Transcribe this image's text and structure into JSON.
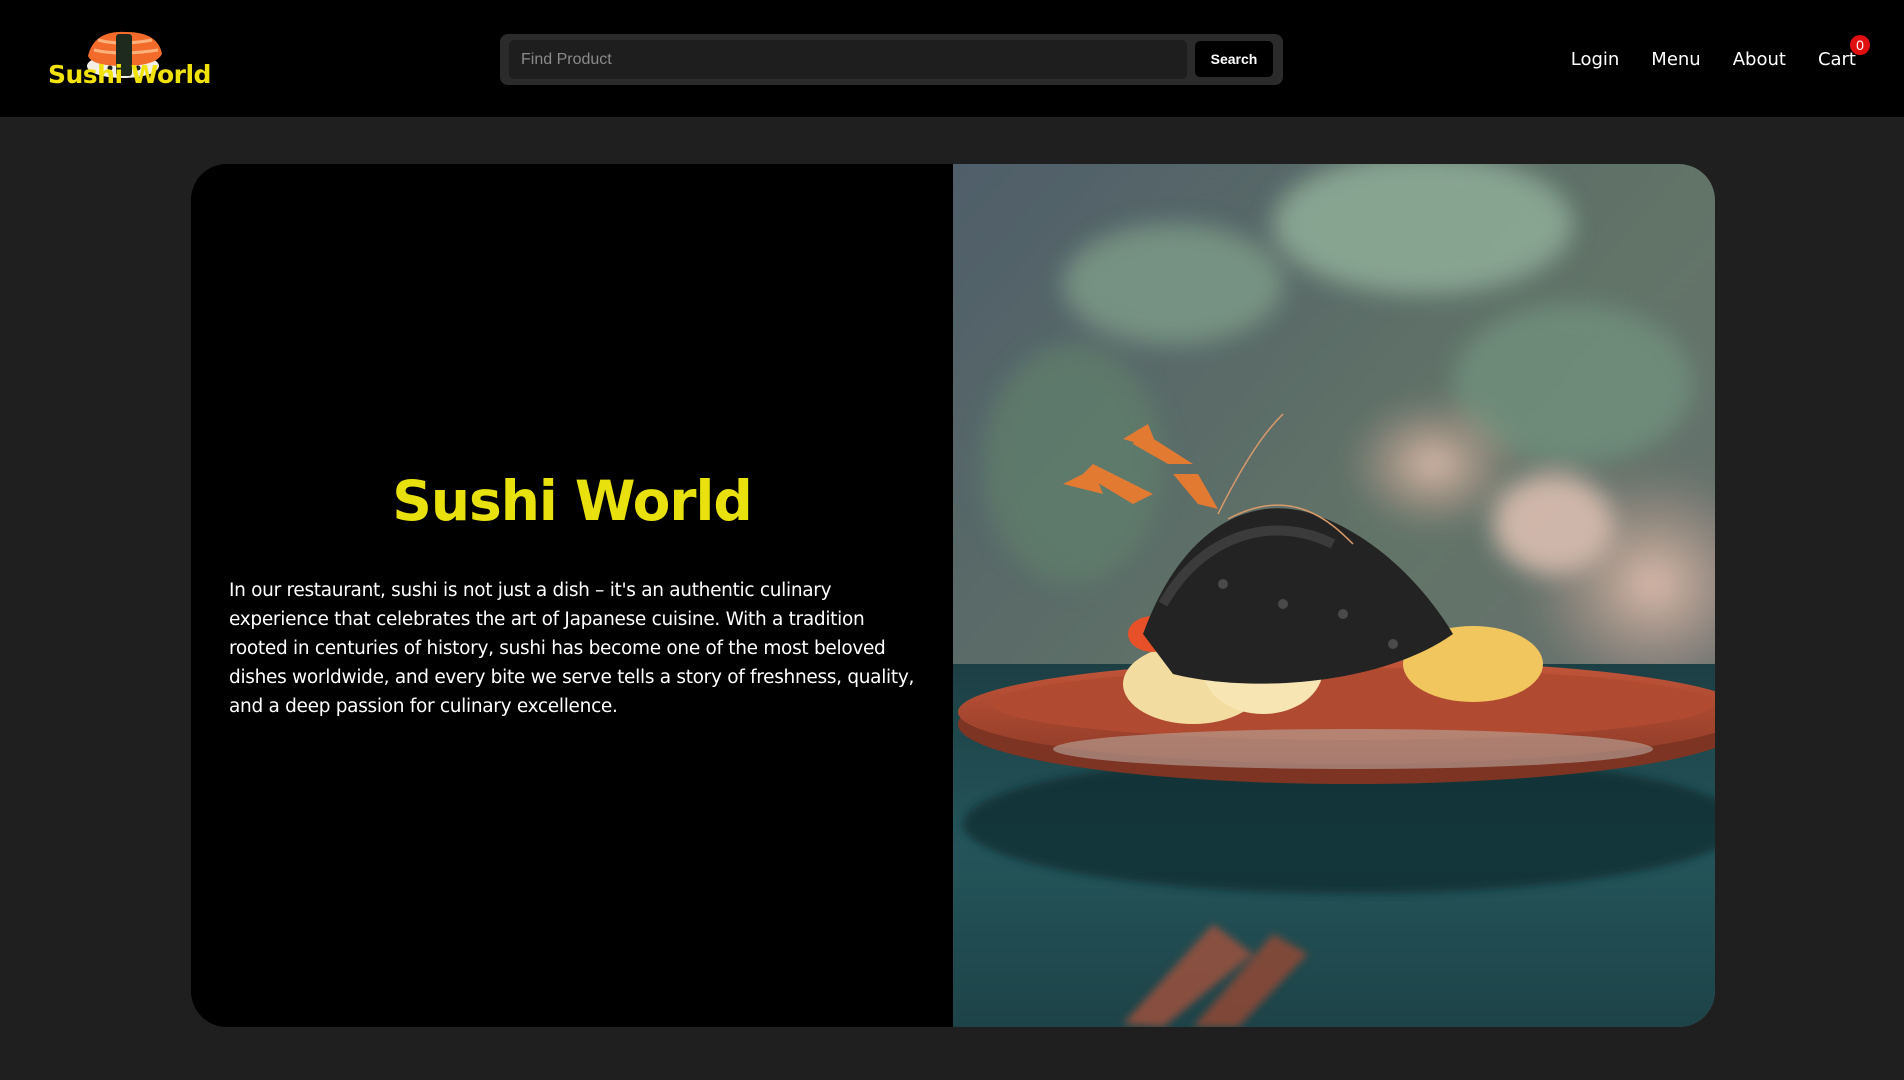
{
  "header": {
    "logo_text": "Sushi World",
    "search": {
      "placeholder": "Find Product",
      "value": "",
      "button_label": "Search"
    },
    "nav": {
      "login": "Login",
      "menu": "Menu",
      "about": "About",
      "cart": "Cart",
      "cart_count": "0"
    }
  },
  "hero": {
    "title": "Sushi World",
    "description": "In our restaurant, sushi is not just a dish – it's an authentic culinary experience that celebrates the art of Japanese cuisine. With a tradition rooted in centuries of history, sushi has become one of the most beloved dishes worldwide, and every bite we serve tells a story of freshness, quality, and a deep passion for culinary excellence."
  },
  "colors": {
    "accent_yellow": "#e8e10d",
    "header_bg": "#000000",
    "page_bg": "#1f1f1f",
    "badge_red": "#e01010"
  },
  "icons": [
    "sushi-logo-icon"
  ]
}
